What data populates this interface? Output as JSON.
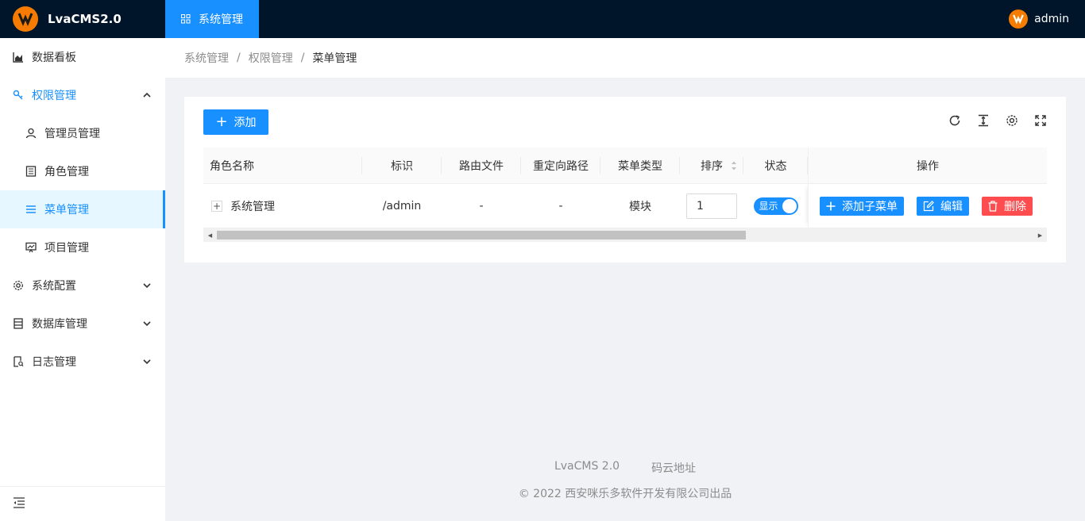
{
  "header": {
    "app_title": "LvaCMS2.0",
    "top_menu_label": "系统管理",
    "user_name": "admin"
  },
  "sidebar": {
    "items": [
      {
        "label": "数据看板",
        "icon": "area-chart-icon"
      },
      {
        "label": "权限管理",
        "icon": "key-icon",
        "expanded": true
      },
      {
        "label": "管理员管理",
        "icon": "user-icon"
      },
      {
        "label": "角色管理",
        "icon": "id-card-icon"
      },
      {
        "label": "菜单管理",
        "icon": "menu-icon",
        "active": true
      },
      {
        "label": "项目管理",
        "icon": "fund-projection-icon"
      },
      {
        "label": "系统配置",
        "icon": "setting-icon"
      },
      {
        "label": "数据库管理",
        "icon": "database-icon"
      },
      {
        "label": "日志管理",
        "icon": "file-search-icon"
      }
    ]
  },
  "breadcrumb": [
    "系统管理",
    "权限管理",
    "菜单管理"
  ],
  "toolbar": {
    "add_label": "添加"
  },
  "table": {
    "columns": [
      "角色名称",
      "标识",
      "路由文件",
      "重定向路径",
      "菜单类型",
      "排序",
      "状态",
      "操作"
    ],
    "rows": [
      {
        "name": "系统管理",
        "identifier": "/admin",
        "route_file": "-",
        "redirect": "-",
        "menu_type": "模块",
        "sort": "1",
        "status": "显示",
        "actions": {
          "add_sub": "添加子菜单",
          "edit": "编辑",
          "delete": "删除"
        }
      }
    ]
  },
  "footer": {
    "link1": "LvaCMS 2.0",
    "link2": "码云地址",
    "copyright": "2022 西安咪乐多软件开发有限公司出品"
  },
  "colors": {
    "primary": "#1890ff",
    "danger": "#ff4d4f",
    "header_bg": "#001529"
  }
}
